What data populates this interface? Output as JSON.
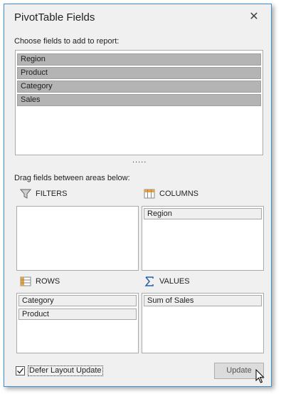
{
  "window": {
    "title": "PivotTable Fields"
  },
  "fields": {
    "label": "Choose fields to add to report:",
    "items": [
      "Region",
      "Product",
      "Category",
      "Sales"
    ]
  },
  "splitter": ".....",
  "areas": {
    "label": "Drag fields between areas below:",
    "filters": {
      "label": "FILTERS",
      "icon": "filter-icon",
      "items": []
    },
    "columns": {
      "label": "COLUMNS",
      "icon": "columns-icon",
      "items": [
        "Region"
      ]
    },
    "rows": {
      "label": "ROWS",
      "icon": "rows-icon",
      "items": [
        "Category",
        "Product"
      ]
    },
    "values": {
      "label": "VALUES",
      "icon": "sigma-icon",
      "items": [
        "Sum of Sales"
      ]
    }
  },
  "defer": {
    "label": "Defer Layout Update",
    "checked": true
  },
  "update_button": {
    "label": "Update"
  },
  "colors": {
    "accent_border": "#3c8fd6",
    "selected_field": "#b4b4b4",
    "icon_orange": "#e8a33d"
  }
}
